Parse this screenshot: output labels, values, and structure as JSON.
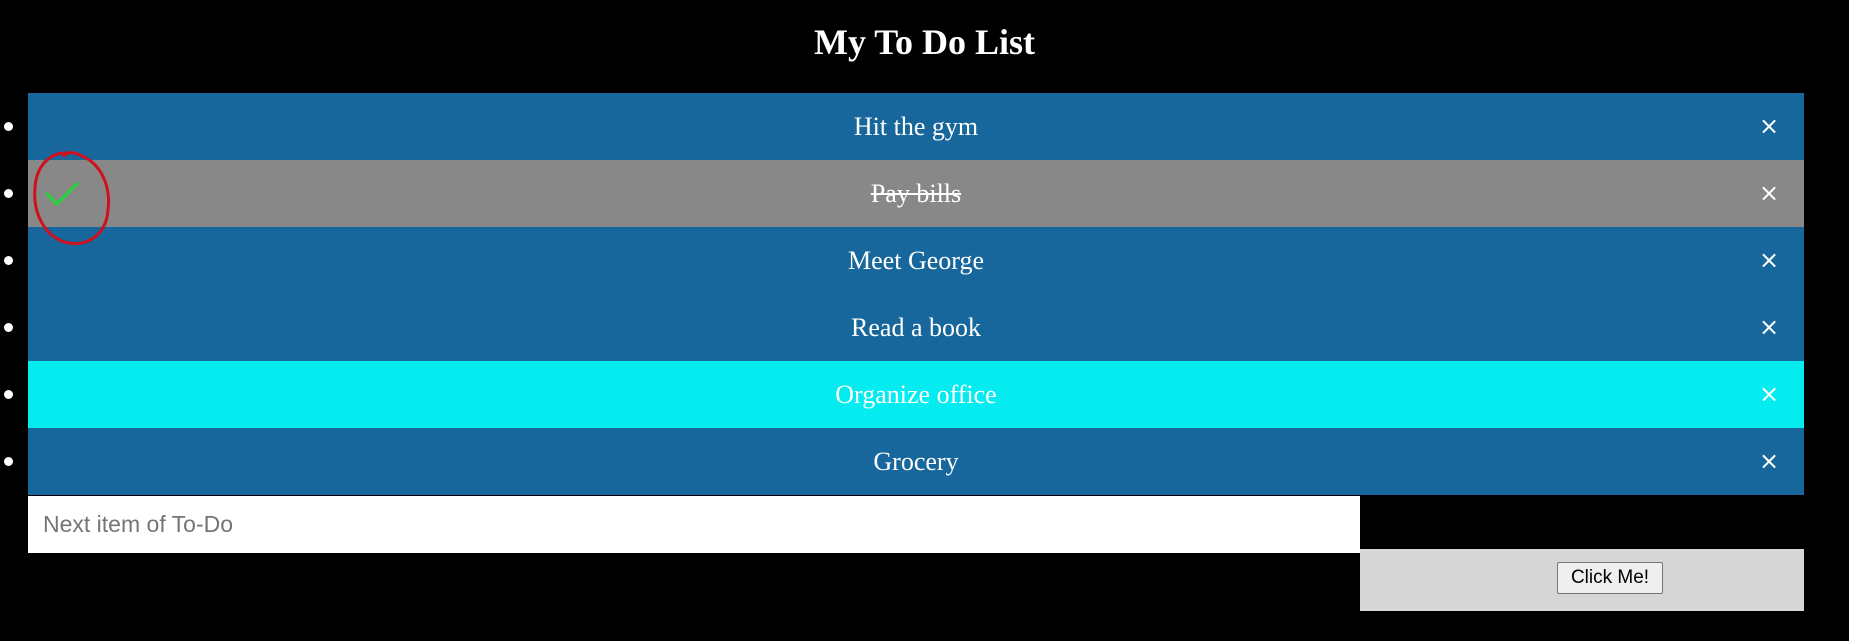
{
  "header": {
    "title": "My To Do List"
  },
  "todos": [
    {
      "text": "Hit the gym",
      "state": "normal"
    },
    {
      "text": "Pay bills",
      "state": "checked"
    },
    {
      "text": "Meet George",
      "state": "normal"
    },
    {
      "text": "Read a book",
      "state": "normal"
    },
    {
      "text": "Organize office",
      "state": "hover"
    },
    {
      "text": "Grocery",
      "state": "normal"
    }
  ],
  "close_glyph": "×",
  "input": {
    "placeholder": "Next item of To-Do",
    "value": ""
  },
  "add_button": {
    "label": "Click Me!"
  },
  "colors": {
    "background": "#000000",
    "item": "#17679c",
    "item_checked": "#888888",
    "item_hover": "#04ecef",
    "check_mark": "#2ecc40",
    "annotation": "#d0101c",
    "add_area": "#d6d6d6"
  },
  "icons": {
    "check": "check-icon",
    "close": "close-icon",
    "bullet": "bullet-icon",
    "annotation": "annotation-circle"
  }
}
